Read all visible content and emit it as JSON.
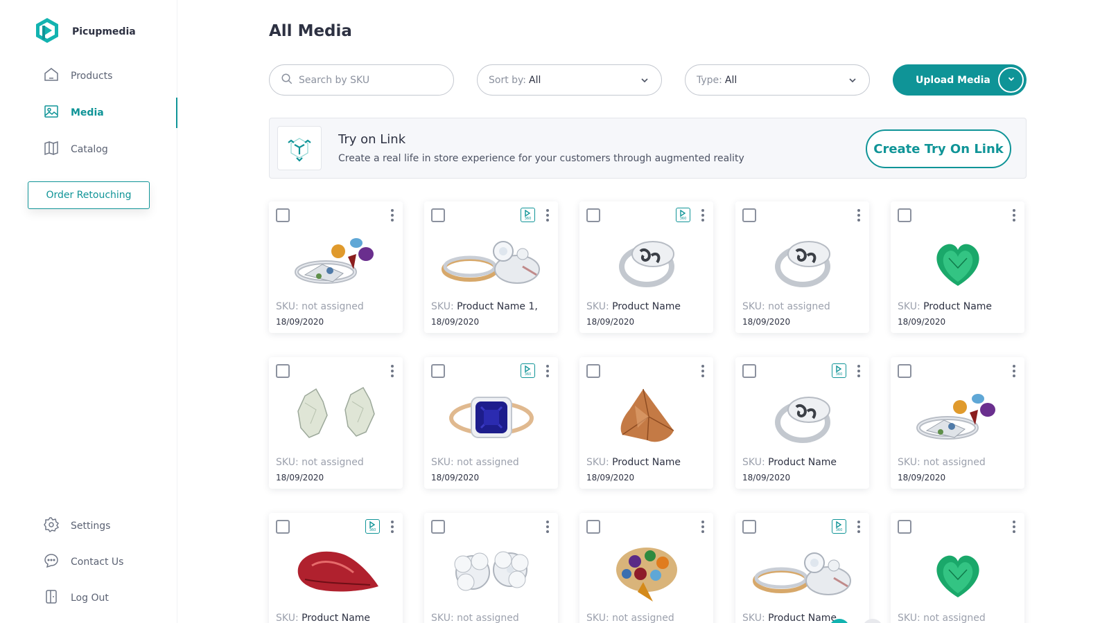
{
  "brand": {
    "name": "Picupmedia",
    "logo_icon": "picupmedia-logo-icon",
    "accent": "#0f9497"
  },
  "sidebar": {
    "nav": [
      {
        "label": "Products",
        "icon": "home-icon"
      },
      {
        "label": "Media",
        "icon": "image-icon"
      },
      {
        "label": "Catalog",
        "icon": "book-icon"
      }
    ],
    "active": "Media",
    "order_button": "Order Retouching",
    "bottom": [
      {
        "label": "Settings",
        "icon": "gear-icon"
      },
      {
        "label": "Contact Us",
        "icon": "chat-icon"
      },
      {
        "label": "Log Out",
        "icon": "logout-icon"
      }
    ]
  },
  "header": {
    "title": "All Media"
  },
  "filters": {
    "search_placeholder": "Search by SKU",
    "sort_label": "Sort by:",
    "sort_value": "All",
    "type_label": "Type:",
    "type_value": "All",
    "upload_label": "Upload Media"
  },
  "tryon": {
    "title": "Try on Link",
    "description": "Create a real life in store experience for your customers through augmented reality",
    "button": "Create Try On Link"
  },
  "media": {
    "sku_prefix": "SKU:",
    "video_badge": "360",
    "items": [
      {
        "sku": "not assigned",
        "date": "18/09/2020",
        "video": false,
        "image": "gemstone-cluster-ring"
      },
      {
        "sku": "Product Name 1,",
        "date": "18/09/2020",
        "video": true,
        "image": "diamond-stack-rings"
      },
      {
        "sku": "Product Name",
        "date": "18/09/2020",
        "video": true,
        "image": "signet-ring"
      },
      {
        "sku": "not assigned",
        "date": "18/09/2020",
        "video": false,
        "image": "signet-ring"
      },
      {
        "sku": "Product Name",
        "date": "18/09/2020",
        "video": false,
        "image": "emerald-heart"
      },
      {
        "sku": "not assigned",
        "date": "18/09/2020",
        "video": false,
        "image": "diamond-earrings"
      },
      {
        "sku": "not assigned",
        "date": "18/09/2020",
        "video": true,
        "image": "sapphire-halo-ring"
      },
      {
        "sku": "Product Name",
        "date": "18/09/2020",
        "video": false,
        "image": "trillion-gem"
      },
      {
        "sku": "Product Name",
        "date": "18/09/2020",
        "video": true,
        "image": "signet-ring"
      },
      {
        "sku": "not assigned",
        "date": "18/09/2020",
        "video": false,
        "image": "gemstone-cluster-ring"
      },
      {
        "sku": "Product Name",
        "date": "",
        "video": true,
        "image": "ruby-pear"
      },
      {
        "sku": "not assigned",
        "date": "",
        "video": false,
        "image": "diamond-flower-ring"
      },
      {
        "sku": "not assigned",
        "date": "",
        "video": false,
        "image": "multi-gem-cluster"
      },
      {
        "sku": "Product Name",
        "date": "",
        "video": true,
        "image": "diamond-stack-rings"
      },
      {
        "sku": "not assigned",
        "date": "",
        "video": false,
        "image": "emerald-heart"
      }
    ]
  }
}
